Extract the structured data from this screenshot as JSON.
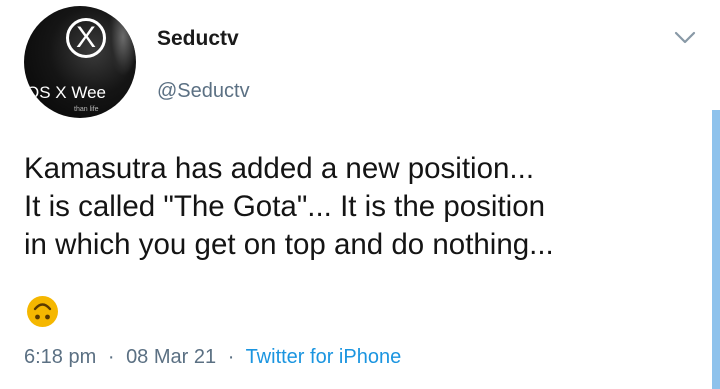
{
  "author": {
    "display_name": "Seductv",
    "handle": "@Seductv",
    "avatar_letter": "X",
    "avatar_band_text": "OS X Wee",
    "avatar_tiny_text": "than life"
  },
  "tweet": {
    "lines": [
      "Kamasutra has added a new position...",
      "It is called \"The Gota\"... It is the position",
      "in which you get on top and do nothing..."
    ],
    "emoji": "upside-down-face-emoji"
  },
  "meta": {
    "time": "6:18 pm",
    "separator": "·",
    "date": "08 Mar 21",
    "source": "Twitter for iPhone"
  },
  "colors": {
    "text": "#141414",
    "muted": "#5b7083",
    "link": "#1b95e0",
    "emoji": "#f5b700",
    "edge_bar": "#8ec2ec"
  }
}
